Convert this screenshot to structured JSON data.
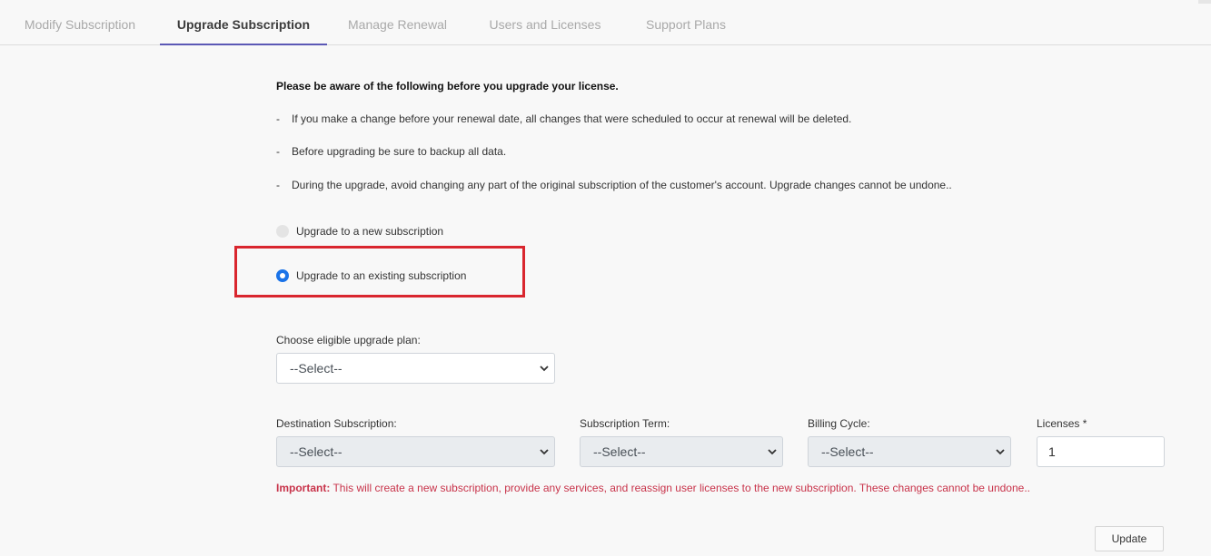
{
  "tabs": [
    {
      "label": "Modify Subscription",
      "active": false
    },
    {
      "label": "Upgrade Subscription",
      "active": true
    },
    {
      "label": "Manage Renewal",
      "active": false
    },
    {
      "label": "Users and Licenses",
      "active": false
    },
    {
      "label": "Support Plans",
      "active": false
    }
  ],
  "notice": {
    "title": "Please be aware of the following before you upgrade your license.",
    "bullets": [
      "If you make a change before your renewal date, all changes that were scheduled to occur at renewal will be deleted.",
      "Before upgrading be sure to backup all data.",
      "During the upgrade, avoid changing any part of the original subscription of the customer's account. Upgrade changes cannot be undone.."
    ],
    "dash": "-"
  },
  "upgrade_options": [
    {
      "label": "Upgrade to a new subscription",
      "selected": false
    },
    {
      "label": "Upgrade to an existing subscription",
      "selected": true
    }
  ],
  "upgrade_plan": {
    "label": "Choose eligible upgrade plan:",
    "value": "--Select--"
  },
  "destination_subscription": {
    "label": "Destination Subscription:",
    "value": "--Select--"
  },
  "subscription_term": {
    "label": "Subscription Term:",
    "value": "--Select--"
  },
  "billing_cycle": {
    "label": "Billing Cycle:",
    "value": "--Select--"
  },
  "licenses": {
    "label": "Licenses *",
    "value": "1"
  },
  "important": {
    "prefix": "Important:",
    "text": " This will create a new subscription, provide any services, and reassign user licenses to the new subscription. These changes cannot be undone.."
  },
  "update_button": "Update",
  "colors": {
    "accent": "#5b58b5",
    "radio_selected": "#1a73e8",
    "highlight": "#d9262e",
    "important_text": "#c8334a"
  }
}
